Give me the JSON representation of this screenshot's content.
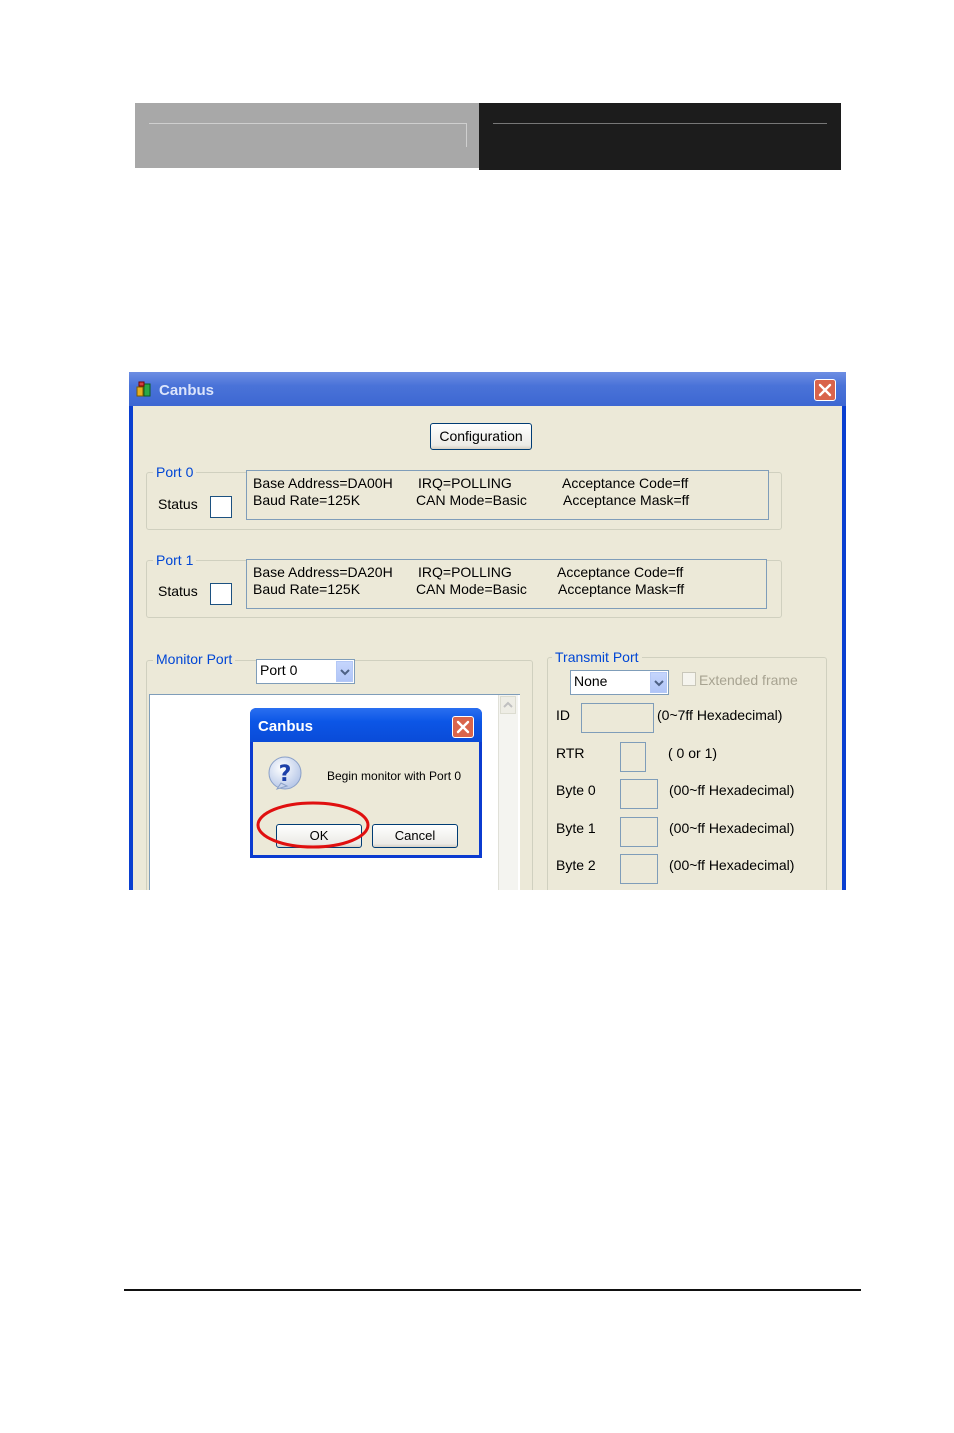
{
  "window": {
    "title": "Canbus",
    "configuration_label": "Configuration",
    "port0": {
      "legend": "Port 0",
      "status_label": "Status",
      "base_address": "Base Address=DA00H",
      "baud_rate": "Baud Rate=125K",
      "irq": "IRQ=POLLING",
      "can_mode": "CAN Mode=Basic",
      "acceptance_code": "Acceptance Code=ff",
      "acceptance_mask": "Acceptance Mask=ff"
    },
    "port1": {
      "legend": "Port 1",
      "status_label": "Status",
      "base_address": "Base Address=DA20H",
      "baud_rate": "Baud Rate=125K",
      "irq": "IRQ=POLLING",
      "can_mode": "CAN Mode=Basic",
      "acceptance_code": "Acceptance Code=ff",
      "acceptance_mask": "Acceptance Mask=ff"
    },
    "monitor": {
      "legend": "Monitor Port",
      "selected": "Port 0"
    },
    "transmit": {
      "legend": "Transmit Port",
      "selected": "None",
      "extended_label": "Extended frame",
      "id_label": "ID",
      "id_hint": "(0~7ff Hexadecimal)",
      "rtr_label": "RTR",
      "rtr_hint": "( 0 or 1)",
      "byte0_label": "Byte 0",
      "byte0_hint": "(00~ff Hexadecimal)",
      "byte1_label": "Byte 1",
      "byte1_hint": "(00~ff Hexadecimal)",
      "byte2_label": "Byte 2",
      "byte2_hint": "(00~ff Hexadecimal)"
    }
  },
  "dialog": {
    "title": "Canbus",
    "message": "Begin monitor with Port 0",
    "ok_label": "OK",
    "cancel_label": "Cancel"
  },
  "colors": {
    "titlebar": "#4a73d8",
    "dialog_titlebar": "#0c56e6",
    "group_legend": "#0046d5",
    "highlight_circle": "#e01010",
    "window_face": "#ece9d8"
  },
  "icons": [
    "app-icon",
    "close-icon",
    "question-icon",
    "dropdown-arrow-icon"
  ]
}
